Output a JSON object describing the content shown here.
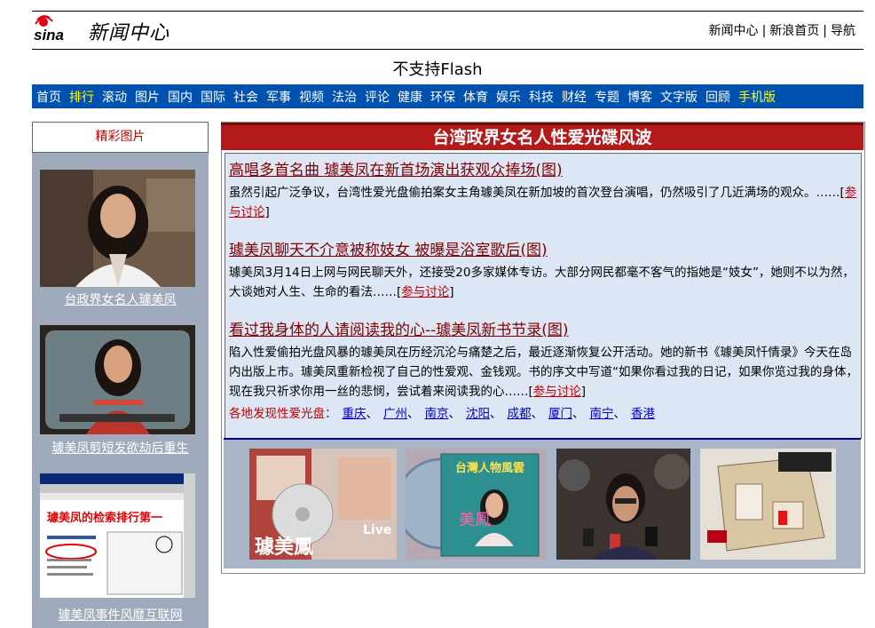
{
  "header": {
    "logo_text": "sina",
    "title": "新闻中心",
    "links": [
      "新闻中心",
      "新浪首页",
      "导航"
    ],
    "separator": "|"
  },
  "flash_notice": "不支持Flash",
  "nav": {
    "items": [
      {
        "label": "首页",
        "highlight": false
      },
      {
        "label": "排行",
        "highlight": true
      },
      {
        "label": "滚动",
        "highlight": false
      },
      {
        "label": "图片",
        "highlight": false
      },
      {
        "label": "国内",
        "highlight": false
      },
      {
        "label": "国际",
        "highlight": false
      },
      {
        "label": "社会",
        "highlight": false
      },
      {
        "label": "军事",
        "highlight": false
      },
      {
        "label": "视频",
        "highlight": false
      },
      {
        "label": "法治",
        "highlight": false
      },
      {
        "label": "评论",
        "highlight": false
      },
      {
        "label": "健康",
        "highlight": false
      },
      {
        "label": "环保",
        "highlight": false
      },
      {
        "label": "体育",
        "highlight": false
      },
      {
        "label": "娱乐",
        "highlight": false
      },
      {
        "label": "科技",
        "highlight": false
      },
      {
        "label": "财经",
        "highlight": false
      },
      {
        "label": "专题",
        "highlight": false
      },
      {
        "label": "博客",
        "highlight": false
      },
      {
        "label": "文字版",
        "highlight": false
      },
      {
        "label": "回顾",
        "highlight": false
      },
      {
        "label": "手机版",
        "highlight": true
      }
    ]
  },
  "sidebar": {
    "heading": "精彩图片",
    "pictures": [
      {
        "caption": "台政界女名人璩美凤"
      },
      {
        "caption": "璩美凤剪短发欲劫后重生"
      },
      {
        "caption": "璩美凤事件风靡互联网"
      }
    ],
    "third_pic_overlay": "璩美凤的检索排行第一"
  },
  "main": {
    "title": "台湾政界女名人性爱光碟风波",
    "articles": [
      {
        "title": "高唱多首名曲 璩美凤在新首场演出获观众捧场(图)",
        "body": "虽然引起广泛争议，台湾性爱光盘偷拍案女主角璩美凤在新加坡的首次登台演唱，仍然吸引了几近满场的观众。……",
        "discuss": "参与讨论"
      },
      {
        "title": "璩美凤聊天不介意被称妓女 被曝是浴室歌后(图)",
        "body": "璩美凤3月14日上网与网民聊天外，还接受20多家媒体专访。大部分网民都毫不客气的指她是“妓女”，她则不以为然，大谈她对人生、生命的看法……",
        "discuss": "参与讨论"
      },
      {
        "title": "看过我身体的人请阅读我的心--璩美凤新书节录(图)",
        "body": "陷入性爱偷拍光盘风暴的璩美凤在历经沉沦与痛楚之后，最近逐渐恢复公开活动。她的新书《璩美凤忏情录》今天在岛内出版上市。璩美凤重新检视了自己的性爱观、金钱观。书的序文中写道“如果你看过我的日记，如果你览过我的身体，现在我只祈求你用一丝的悲悯，尝试着来阅读我的心……",
        "discuss": "参与讨论"
      }
    ],
    "cities_label": "各地发现性爱光盘：",
    "cities": [
      "重庆",
      "广州",
      "南京",
      "沈阳",
      "成都",
      "厦门",
      "南宁",
      "香港"
    ],
    "photo_overlays": {
      "magazine_text": "璩美鳳",
      "cd_title": "台灣人物風雲",
      "cd_name": "美鳳"
    }
  },
  "colors": {
    "nav_bg": "#0052b0",
    "nav_highlight": "#ffff00",
    "title_bar": "#b31a1a",
    "link_dark_red": "#800000",
    "discuss_red": "#c00000",
    "city_blue": "#0000cc",
    "panel_bg": "#dde6f4",
    "sidebar_bg": "#a0aabd"
  }
}
